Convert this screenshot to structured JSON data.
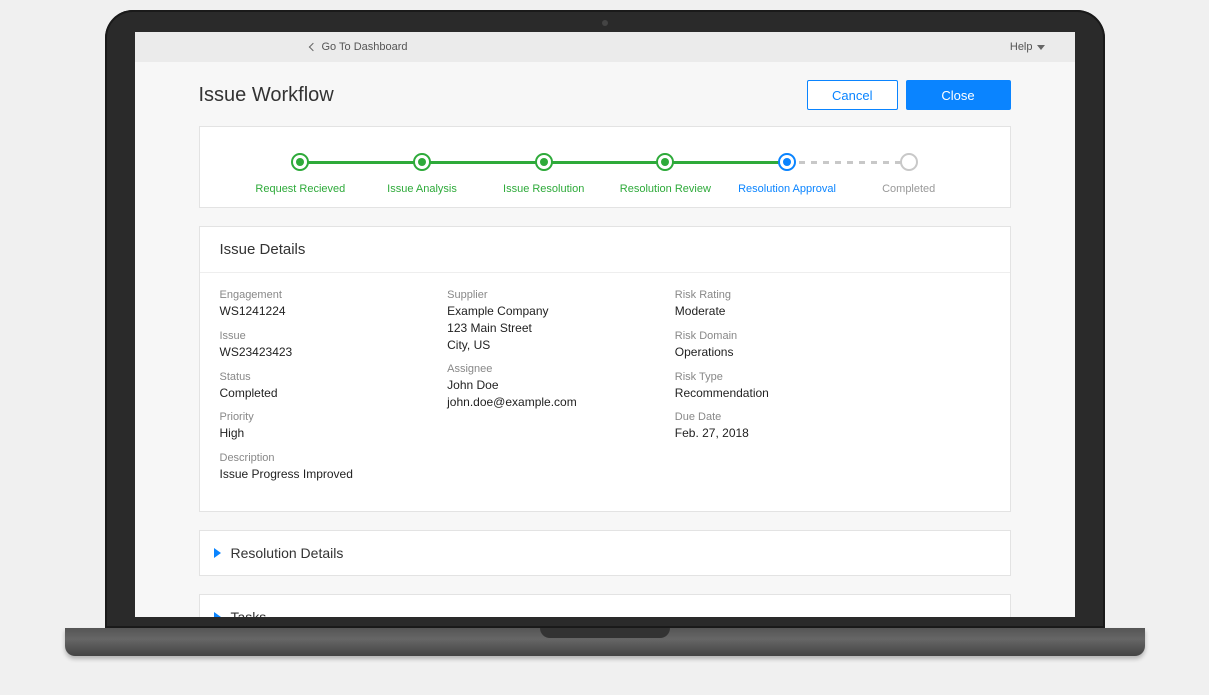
{
  "topbar": {
    "dashboard_link": "Go To Dashboard",
    "help_label": "Help"
  },
  "header": {
    "title": "Issue Workflow",
    "cancel_label": "Cancel",
    "close_label": "Close"
  },
  "workflow_steps": {
    "s0": {
      "label": "Request Recieved"
    },
    "s1": {
      "label": "Issue Analysis"
    },
    "s2": {
      "label": "Issue Resolution"
    },
    "s3": {
      "label": "Resolution Review"
    },
    "s4": {
      "label": "Resolution Approval"
    },
    "s5": {
      "label": "Completed"
    }
  },
  "issue_details": {
    "section_title": "Issue Details",
    "engagement": {
      "label": "Engagement",
      "value": "WS1241224"
    },
    "issue": {
      "label": "Issue",
      "value": "WS23423423"
    },
    "status": {
      "label": "Status",
      "value": "Completed"
    },
    "priority": {
      "label": "Priority",
      "value": "High"
    },
    "description": {
      "label": "Description",
      "value": "Issue Progress Improved"
    },
    "supplier": {
      "label": "Supplier",
      "line1": "Example Company",
      "line2": "123 Main Street",
      "line3": "City, US"
    },
    "assignee": {
      "label": "Assignee",
      "name": "John Doe",
      "email": "john.doe@example.com"
    },
    "risk_rating": {
      "label": "Risk Rating",
      "value": "Moderate"
    },
    "risk_domain": {
      "label": "Risk Domain",
      "value": "Operations"
    },
    "risk_type": {
      "label": "Risk Type",
      "value": "Recommendation"
    },
    "due_date": {
      "label": "Due Date",
      "value": "Feb. 27, 2018"
    }
  },
  "sections": {
    "resolution_details": "Resolution Details",
    "tasks": "Tasks"
  }
}
